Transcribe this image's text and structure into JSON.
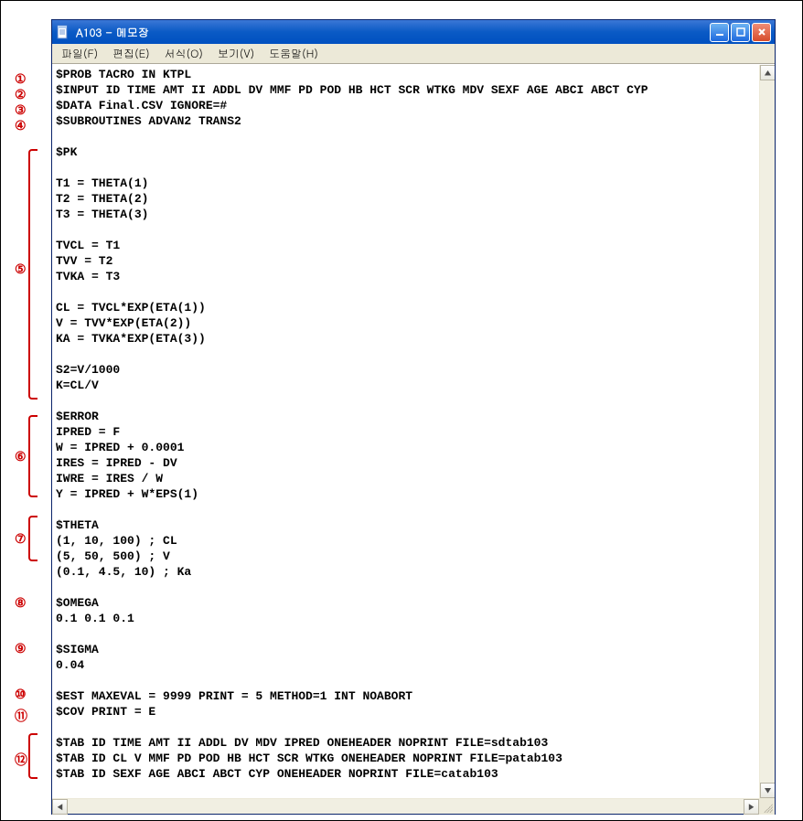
{
  "window": {
    "title": "A103 - 메모장"
  },
  "menu": {
    "file": "파일(F)",
    "edit": "편집(E)",
    "format": "서식(O)",
    "view": "보기(V)",
    "help": "도움말(H)"
  },
  "annotations": {
    "a1": "①",
    "a2": "②",
    "a3": "③",
    "a4": "④",
    "a5": "⑤",
    "a6": "⑥",
    "a7": "⑦",
    "a8": "⑧",
    "a9": "⑨",
    "a10": "⑩",
    "a11": "⑪",
    "a12": "⑫"
  },
  "content": {
    "l1": "$PROB TACRO IN KTPL",
    "l2": "$INPUT ID TIME AMT II ADDL DV MMF PD POD HB HCT SCR WTKG MDV SEXF AGE ABCI ABCT CYP",
    "l3": "$DATA Final.CSV IGNORE=#",
    "l4": "$SUBROUTINES ADVAN2 TRANS2",
    "l5": "",
    "l6": "$PK",
    "l7": "",
    "l8": "T1 = THETA(1)",
    "l9": "T2 = THETA(2)",
    "l10": "T3 = THETA(3)",
    "l11": "",
    "l12": "TVCL = T1",
    "l13": "TVV = T2",
    "l14": "TVKA = T3",
    "l15": "",
    "l16": "CL = TVCL*EXP(ETA(1))",
    "l17": "V = TVV*EXP(ETA(2))",
    "l18": "KA = TVKA*EXP(ETA(3))",
    "l19": "",
    "l20": "S2=V/1000",
    "l21": "K=CL/V",
    "l22": "",
    "l23": "$ERROR",
    "l24": "IPRED = F",
    "l25": "W = IPRED + 0.0001",
    "l26": "IRES = IPRED - DV",
    "l27": "IWRE = IRES / W",
    "l28": "Y = IPRED + W*EPS(1)",
    "l29": "",
    "l30": "$THETA",
    "l31": "(1, 10, 100) ; CL",
    "l32": "(5, 50, 500) ; V",
    "l33": "(0.1, 4.5, 10) ; Ka",
    "l34": "",
    "l35": "$OMEGA",
    "l36": "0.1 0.1 0.1",
    "l37": "",
    "l38": "$SIGMA",
    "l39": "0.04",
    "l40": "",
    "l41": "$EST MAXEVAL = 9999 PRINT = 5 METHOD=1 INT NOABORT",
    "l42": "$COV PRINT = E",
    "l43": "",
    "l44": "$TAB ID TIME AMT II ADDL DV MDV IPRED ONEHEADER NOPRINT FILE=sdtab103",
    "l45": "$TAB ID CL V MMF PD POD HB HCT SCR WTKG ONEHEADER NOPRINT FILE=patab103",
    "l46": "$TAB ID SEXF AGE ABCI ABCT CYP ONEHEADER NOPRINT FILE=catab103"
  }
}
